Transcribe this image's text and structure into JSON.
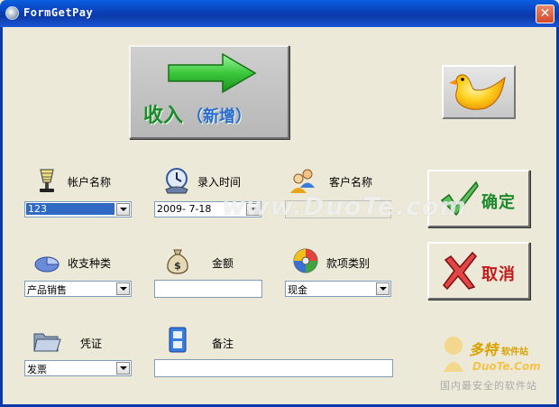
{
  "window": {
    "title": "FormGetPay",
    "close_glyph": "✕"
  },
  "main_button": {
    "label": "收入",
    "sub": "（新增）"
  },
  "fields": {
    "account": {
      "label": "帐户名称",
      "value": "123"
    },
    "entry_time": {
      "label": "录入时间",
      "value": "2009- 7-18"
    },
    "customer": {
      "label": "客户名称",
      "value": ""
    },
    "category": {
      "label": "收支种类",
      "value": "产品销售"
    },
    "amount": {
      "label": "金额",
      "value": ""
    },
    "item_type": {
      "label": "款项类别",
      "value": "现金"
    },
    "voucher": {
      "label": "凭证",
      "value": "发票"
    },
    "remark": {
      "label": "备注",
      "value": ""
    }
  },
  "buttons": {
    "ok": "确定",
    "cancel": "取消"
  },
  "watermark": {
    "center": "www.DuoTe.com",
    "brand": "多特",
    "brand_small": "软件站",
    "url": "DuoTe.Com",
    "slogan": "国内最安全的软件站"
  },
  "icons": {
    "app": "app-icon",
    "arrow": "green-arrow-icon",
    "bird": "yellow-bird-icon",
    "account": "lamp-icon",
    "entry_time": "clock-icon",
    "customer": "people-icon",
    "category": "pie-chart-icon",
    "amount": "money-bag-icon",
    "item_type": "disc-icon",
    "voucher": "folder-icon",
    "remark": "notes-icon",
    "ok": "checkmark-icon",
    "cancel": "cross-icon"
  },
  "colors": {
    "titlebar": "#0a3fb8",
    "accent_green": "#1a8a2a",
    "accent_blue": "#2a6ad0",
    "cancel_red": "#c01c1c"
  }
}
